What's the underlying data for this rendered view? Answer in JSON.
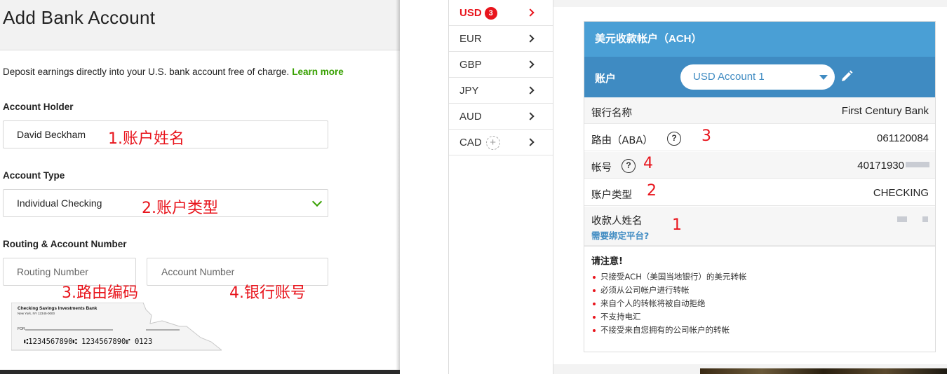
{
  "left": {
    "title": "Add Bank Account",
    "intro": "Deposit earnings directly into your U.S. bank account free of charge.",
    "learn_more": "Learn more",
    "account_holder_label": "Account Holder",
    "account_holder_value": "David Beckham",
    "account_holder_note": "1.账户姓名",
    "account_type_label": "Account Type",
    "account_type_value": "Individual Checking",
    "account_type_note": "2.账户类型",
    "routing_section_label": "Routing & Account Number",
    "routing_placeholder": "Routing Number",
    "account_placeholder": "Account Number",
    "routing_note": "3.路由编码",
    "account_note": "4.银行账号",
    "check": {
      "bank_name": "Checking Savings Investments Bank",
      "bank_city": "New York, NY 12345-0000",
      "for_label": "FOR",
      "micr": "⑆1234567890⑆   1234567890⑈   0123"
    }
  },
  "currencies": [
    {
      "code": "USD",
      "badge": "3",
      "active": true
    },
    {
      "code": "EUR"
    },
    {
      "code": "GBP"
    },
    {
      "code": "JPY"
    },
    {
      "code": "AUD"
    },
    {
      "code": "CAD",
      "plus": "+"
    }
  ],
  "card": {
    "header": "美元收款帐户（ACH）",
    "account_label": "账户",
    "account_select": "USD Account 1",
    "rows": [
      {
        "key": "银行名称",
        "value": "First Century Bank"
      },
      {
        "key": "路由（ABA）",
        "value": "061120084",
        "note": "3"
      },
      {
        "key": "帐号",
        "value": "40171930",
        "note": "4"
      },
      {
        "key": "账户类型",
        "value": "CHECKING",
        "note": "2"
      },
      {
        "key": "收款人姓名",
        "link": "需要绑定平台?",
        "note": "1"
      }
    ],
    "notes_title": "请注意!",
    "notes": [
      "只接受ACH（美国当地银行）的美元转帐",
      "必须从公司帐户进行转帐",
      "来自个人的转帐将被自动拒绝",
      "不支持电汇",
      "不接受来自您拥有的公司帐户的转帐"
    ]
  },
  "colors": {
    "accent_red": "#e8141c",
    "brand_green": "#37a000",
    "card_blue": "#4a9fd5",
    "card_blue_dark": "#3f8bc2"
  },
  "icons": [
    "chevron-down-icon",
    "chevron-right-icon",
    "help-circle-icon",
    "pencil-icon",
    "plus-circle-icon"
  ]
}
